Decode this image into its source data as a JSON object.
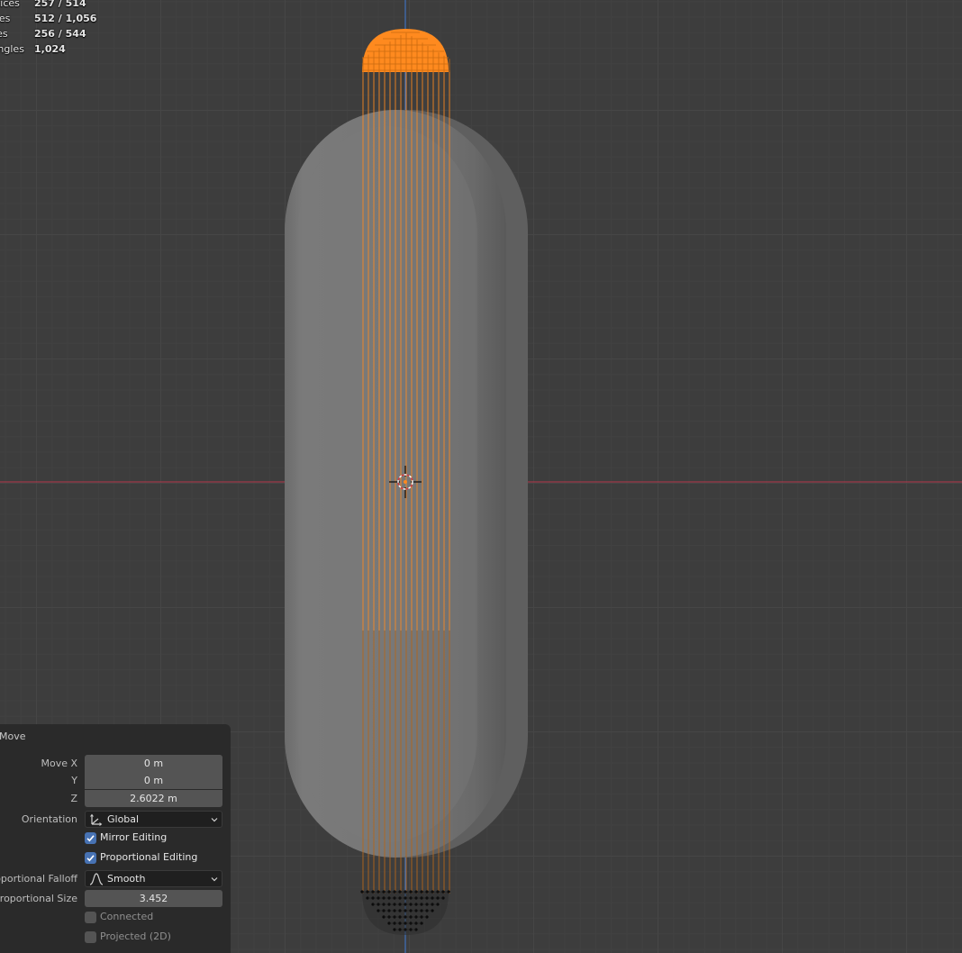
{
  "stats": [
    {
      "label": "Vertices",
      "value": "257 / 514"
    },
    {
      "label": "Edges",
      "value": "512 / 1,056"
    },
    {
      "label": "Faces",
      "value": "256 / 544"
    },
    {
      "label": "Triangles",
      "value": "1,024"
    }
  ],
  "redo_panel": {
    "title": "Move",
    "move_x_label": "Move X",
    "move_x_value": "0 m",
    "y_label": "Y",
    "y_value": "0 m",
    "z_label": "Z",
    "z_value": "2.6022 m",
    "orientation_label": "Orientation",
    "orientation_value": "Global",
    "mirror_label": "Mirror Editing",
    "mirror_checked": true,
    "proportional_label": "Proportional Editing",
    "proportional_checked": true,
    "falloff_label": "Proportional Falloff",
    "falloff_value": "Smooth",
    "size_label": "Proportional Size",
    "size_value": "3.452",
    "connected_label": "Connected",
    "connected_checked": false,
    "projected_label": "Projected (2D)",
    "projected_checked": false
  },
  "colors": {
    "viewport_bg": "#3d3d3d",
    "selection": "#ff8a1f",
    "x_axis": "#b5384a",
    "z_axis": "#3f7ad6",
    "checkbox_on": "#4772b3"
  },
  "icons": [
    "orientation-global-icon",
    "smooth-falloff-icon",
    "chevron-down-icon",
    "3d-cursor-icon"
  ]
}
